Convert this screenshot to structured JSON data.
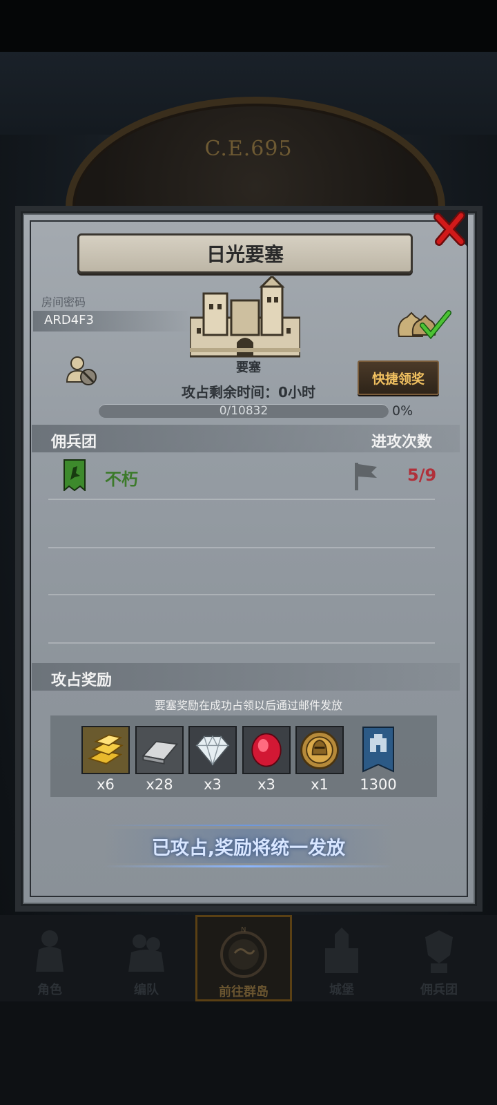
{
  "background": {
    "era_label": "C.E.695"
  },
  "dialog": {
    "title": "日光要塞",
    "room": {
      "label": "房间密码",
      "code": "ARD4F3"
    },
    "fortress": {
      "type_label": "要塞"
    },
    "quick_claim_button": "快捷领奖",
    "capture_time": "攻占剩余时间：0小时",
    "progress": {
      "text": "0/10832",
      "percent_label": "0%",
      "fraction": 0.0
    },
    "mercenary_section": {
      "title": "佣兵团",
      "attacks_header": "进攻次数",
      "rows": [
        {
          "name": "不朽",
          "attacks": "5/9"
        }
      ]
    },
    "rewards_section": {
      "title": "攻占奖励",
      "note": "要塞奖励在成功占领以后通过邮件发放",
      "items": [
        {
          "icon": "gold-bars-icon",
          "qty": "x6"
        },
        {
          "icon": "iron-ingot-icon",
          "qty": "x28"
        },
        {
          "icon": "diamond-icon",
          "qty": "x3"
        },
        {
          "icon": "ruby-icon",
          "qty": "x3"
        },
        {
          "icon": "knight-medal-icon",
          "qty": "x1"
        },
        {
          "icon": "guild-banner-icon",
          "qty": "1300"
        }
      ]
    },
    "status_button": "已攻占,奖励将统一发放"
  },
  "nav": {
    "items": [
      {
        "label": "角色",
        "icon": "character-icon"
      },
      {
        "label": "编队",
        "icon": "formation-icon"
      },
      {
        "label": "前往群岛",
        "icon": "compass-map-icon",
        "active": true
      },
      {
        "label": "城堡",
        "icon": "castle-icon"
      },
      {
        "label": "佣兵团",
        "icon": "mercenary-icon"
      }
    ]
  },
  "colors": {
    "accent_gold": "#f0c060",
    "guild_green": "#3c7a2a",
    "attack_red": "#b0303a",
    "panel_gray": "#959ca3"
  }
}
